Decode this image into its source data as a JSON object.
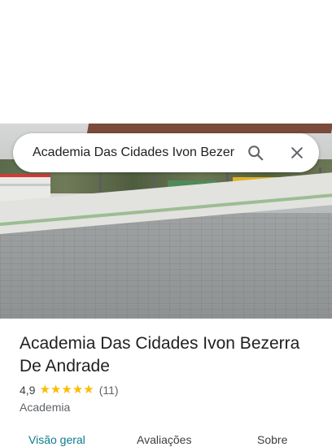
{
  "search": {
    "query": "Academia Das Cidades Ivon Bezerra",
    "search_icon": "search-icon",
    "close_icon": "close-icon"
  },
  "place": {
    "name": "Academia Das Cidades Ivon Bezerra De Andrade",
    "rating": "4,9",
    "stars": 5,
    "review_count": "(11)",
    "category": "Academia"
  },
  "tabs": [
    {
      "label": "Visão geral",
      "active": true
    },
    {
      "label": "Avaliações",
      "active": false
    },
    {
      "label": "Sobre",
      "active": false
    }
  ],
  "colors": {
    "accent": "#0b7a8e",
    "star": "#fbbc04"
  }
}
